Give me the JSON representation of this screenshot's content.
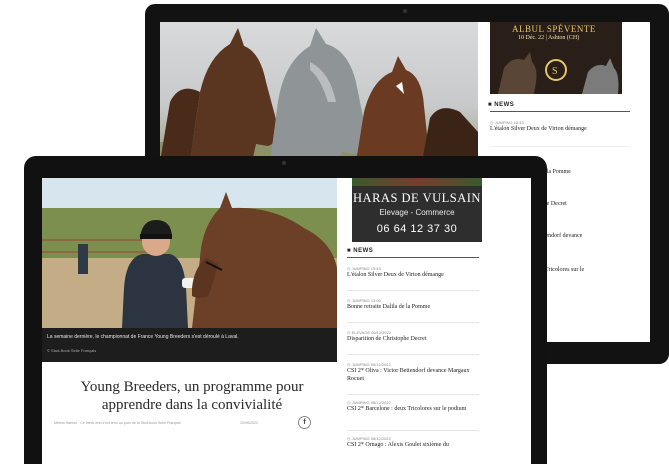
{
  "back_site": {
    "auction_banner": {
      "title": "ALBUL SPÉVENTE",
      "date": "10 Déc. 22 | Ashton (CH)"
    },
    "news_heading": "NEWS",
    "news": [
      {
        "category": "JUMPING",
        "time": "15:43",
        "title": "L'étalon Silver Deux de Virton démange"
      },
      {
        "category": "",
        "time": "",
        "title": "lla de la Pomme"
      },
      {
        "category": "",
        "time": "",
        "title": "istophe Decret"
      },
      {
        "category": "",
        "time": "",
        "title": "r Bettendorf devance"
      },
      {
        "category": "",
        "time": "",
        "title": "deux Tricolores sur le"
      }
    ]
  },
  "front_site": {
    "photo_caption": "La semaine dernière, le championnat de France Young Breeders s'est déroulé à Laval.",
    "photo_credit": "© Stud-Book Selle Français",
    "article_title": "Young Breeders, un programme pour apprendre dans la convivialité",
    "byline": "Mélina Hamon · Ce week-end s'est tenu au parc de la Stud-book Selle Français",
    "article_date": "20/06/2022",
    "share_icon_label": "f",
    "ad": {
      "name": "HARAS DE VULSAIN",
      "subtitle": "Elevage - Commerce",
      "phone": "06 64 12 37 30"
    },
    "news_heading": "NEWS",
    "news": [
      {
        "category": "JUMPING",
        "time": "15:43",
        "title": "L'étalon Silver Deux de Virton démange"
      },
      {
        "category": "JUMPING",
        "time": "13:06",
        "title": "Bonne retraite Dalila de la Pomme"
      },
      {
        "category": "ELEVAGE",
        "time": "06/12/2022",
        "title": "Disparition de Christophe Decret"
      },
      {
        "category": "JUMPING",
        "time": "06/12/2022",
        "title": "CSI 2* Oliva : Victor Bettendorf devance Margaux Rocuet"
      },
      {
        "category": "JUMPING",
        "time": "06/12/2022",
        "title": "CSI 2* Barcelone : deux Tricolores sur le podium"
      },
      {
        "category": "JUMPING",
        "time": "06/12/2022",
        "title": "CSI 2* Ornago : Alexis Goulet sixième du"
      }
    ]
  }
}
